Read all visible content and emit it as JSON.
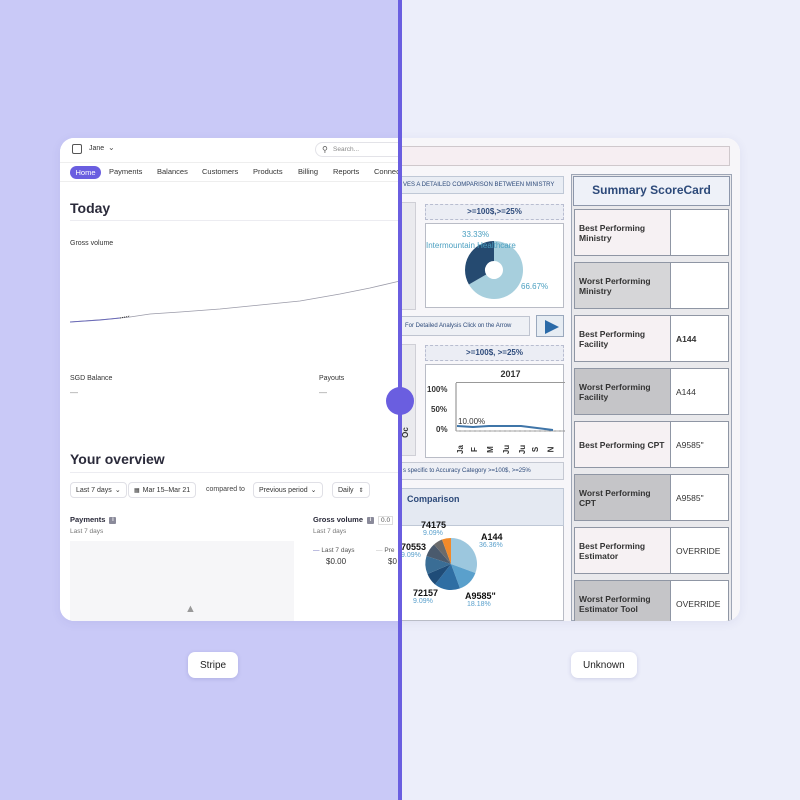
{
  "labels": {
    "left": "Stripe",
    "right": "Unknown"
  },
  "stripe": {
    "account": "Jane",
    "search_placeholder": "Search...",
    "nav": [
      "Home",
      "Payments",
      "Balances",
      "Customers",
      "Products",
      "Billing",
      "Reports",
      "Connect"
    ],
    "today": "Today",
    "gross_volume": "Gross volume",
    "sgd_balance": "SGD Balance",
    "sgd_value": "—",
    "payouts": "Payouts",
    "payouts_value": "—",
    "overview": "Your overview",
    "filters": {
      "range": "Last 7 days",
      "dates": "Mar 15–Mar 21",
      "compared_to": "compared to",
      "previous": "Previous period",
      "interval": "Daily"
    },
    "payments": {
      "title": "Payments",
      "subtitle": "Last 7 days"
    },
    "gross_card": {
      "title": "Gross volume",
      "badge": "0.0",
      "subtitle": "Last 7 days",
      "legend_current": "Last 7 days",
      "value_current": "$0.00",
      "legend_previous": "Pre",
      "value_previous": "$0"
    }
  },
  "dashboard": {
    "banner": "VES A DETAILED COMPARISON BETWEEN MINISTRY",
    "panel1_header": ">=100$,>=25%",
    "panel1_pie": {
      "label_top": "33.33%",
      "label_name": "Intermountain Healthcare",
      "label_bottom": "66.67%"
    },
    "arrow_bar": "For Detailed Analysis Click on the Arrow",
    "panel2_header": ">=100$, >=25%",
    "panel2_chart": {
      "year": "2017",
      "y_ticks": [
        "100%",
        "50%",
        "0%"
      ],
      "point_label": "10.00%",
      "x_ticks": [
        "Ja",
        "F",
        "M",
        "Ju",
        "Ju",
        "S",
        "N"
      ],
      "left_tick": "Oc"
    },
    "bottom_bar": "s specific to Accuracy Category  >=100$, >=25%",
    "comparison_title": "Comparison",
    "comparison_pie": [
      {
        "name": "74175",
        "pct": "9.09%"
      },
      {
        "name": "70553",
        "pct": "9.09%"
      },
      {
        "name": "A144",
        "pct": "36.36%"
      },
      {
        "name": "72157",
        "pct": "9.09%"
      },
      {
        "name": "A9585\"",
        "pct": "18.18%"
      }
    ],
    "scorecard": {
      "title": "Summary ScoreCard",
      "rows": [
        {
          "label": "Best Performing Ministry",
          "value": ""
        },
        {
          "label": "Worst Performing Ministry",
          "value": ""
        },
        {
          "label": "Best Performing Facility",
          "value": "A144"
        },
        {
          "label": "Worst Performing Facility",
          "value": "A144"
        },
        {
          "label": "Best Performing CPT",
          "value": "A9585\""
        },
        {
          "label": "Worst Performing CPT",
          "value": "A9585\""
        },
        {
          "label": "Best Performing Estimator",
          "value": "OVERRIDE"
        },
        {
          "label": "Worst Performing Estimator Tool",
          "value": "OVERRIDE"
        }
      ]
    }
  },
  "colors": {
    "accent": "#6a5ee0",
    "left_bg": "#c9c9f7",
    "right_bg": "#eceefa",
    "pie_dark": "#254a70",
    "pie_light": "#a7cfdd"
  }
}
